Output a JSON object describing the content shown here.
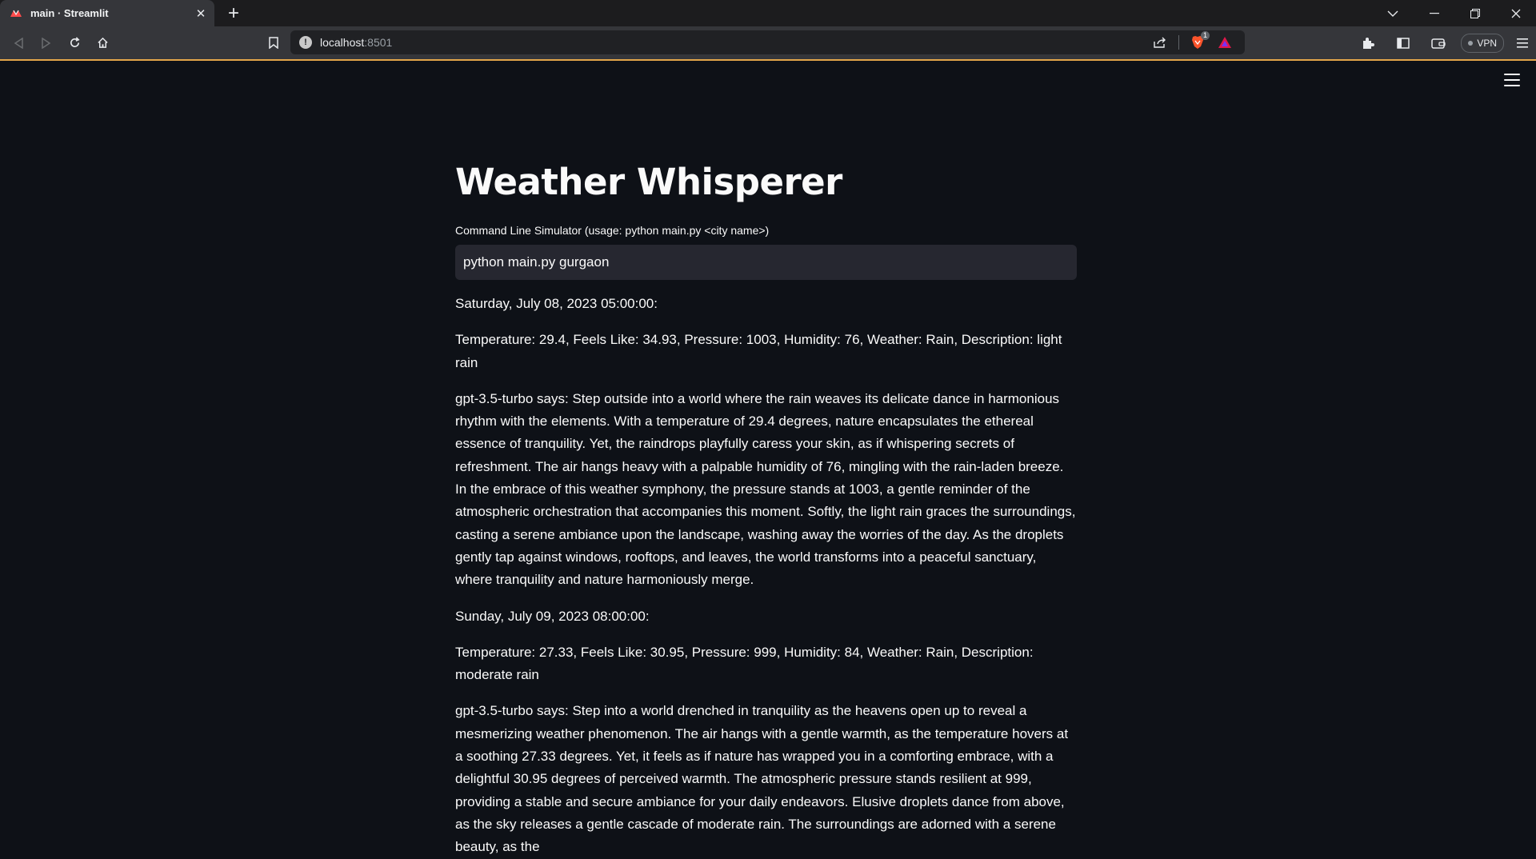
{
  "browser": {
    "tab_title": "main · Streamlit",
    "url_host": "localhost",
    "url_port": ":8501",
    "brave_badge_count": "1",
    "vpn_label": "VPN"
  },
  "app": {
    "title": "Weather Whisperer",
    "input_label": "Command Line Simulator (usage: python main.py <city name>)",
    "input_value": "python main.py gurgaon",
    "entries": [
      {
        "date": "Saturday, July 08, 2023 05:00:00:",
        "stats": "Temperature: 29.4, Feels Like: 34.93, Pressure: 1003, Humidity: 76, Weather: Rain, Description: light rain",
        "narration": "gpt-3.5-turbo says: Step outside into a world where the rain weaves its delicate dance in harmonious rhythm with the elements. With a temperature of 29.4 degrees, nature encapsulates the ethereal essence of tranquility. Yet, the raindrops playfully caress your skin, as if whispering secrets of refreshment. The air hangs heavy with a palpable humidity of 76, mingling with the rain-laden breeze. In the embrace of this weather symphony, the pressure stands at 1003, a gentle reminder of the atmospheric orchestration that accompanies this moment. Softly, the light rain graces the surroundings, casting a serene ambiance upon the landscape, washing away the worries of the day. As the droplets gently tap against windows, rooftops, and leaves, the world transforms into a peaceful sanctuary, where tranquility and nature harmoniously merge."
      },
      {
        "date": "Sunday, July 09, 2023 08:00:00:",
        "stats": "Temperature: 27.33, Feels Like: 30.95, Pressure: 999, Humidity: 84, Weather: Rain, Description: moderate rain",
        "narration": "gpt-3.5-turbo says: Step into a world drenched in tranquility as the heavens open up to reveal a mesmerizing weather phenomenon. The air hangs with a gentle warmth, as the temperature hovers at a soothing 27.33 degrees. Yet, it feels as if nature has wrapped you in a comforting embrace, with a delightful 30.95 degrees of perceived warmth. The atmospheric pressure stands resilient at 999, providing a stable and secure ambiance for your daily endeavors. Elusive droplets dance from above, as the sky releases a gentle cascade of moderate rain. The surroundings are adorned with a serene beauty, as the"
      }
    ]
  },
  "colors": {
    "app_background": "#0e1117",
    "input_background": "#262730",
    "text": "#fafafa",
    "toolbar_accent": "#e3a64a"
  }
}
